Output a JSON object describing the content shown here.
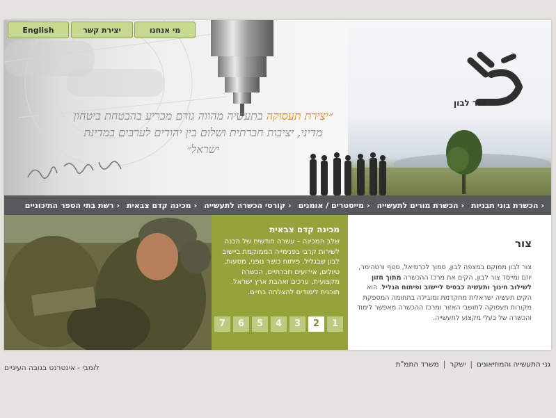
{
  "top_buttons": {
    "english": "English",
    "contact": "יצירת קשר",
    "about": "מי אנחנו"
  },
  "hero": {
    "quote_part1": "״יצירת תעסוקה",
    "quote_part2": " בתעשיה מהווה גורם מכריע בהבטחת ביטחון מדיני, יציבות חברתית ושלום בין יהודים לערבים במדינת ישראל״",
    "logo_text": "צור לבון"
  },
  "nav": {
    "items": [
      "הכשרת בוני תבניות",
      "הכשרת מורים לתעשייה",
      "מייסטרים / אומנים",
      "קורסי הכשרה לתעשייה",
      "מכינה קדם צבאית",
      "רשת בתי הספר התיכוניים"
    ]
  },
  "feature": {
    "title": "מכינה קדם צבאית",
    "text": "שלב המכינה – עשרה חודשים של הכנה לשירות קרבי בפנימייה הממוקמת ביישוב לבון שבגליל. פיתוח כושר גופני, מסעות, טיולים, אירועים חברתיים, הכשרה מקצועית, ערכים ואהבת ארץ ישראל. תוכנית לימודים להצלחה בחיים.",
    "pages": [
      "1",
      "2",
      "3",
      "4",
      "5",
      "6",
      "7"
    ],
    "active_page": "2"
  },
  "about": {
    "title": "צור",
    "text_a": "צור לבון ממוקם במצפה לבון, סמוך לכרמיאל, סטף ורטהימר, יוזם ומייסד צור לבון, הקים את מרכז ההכשרה ",
    "text_bold": "מתוך חזון לשילוב חינוך ותעשיה כבסיס ליישוב ופיתוח הגליל",
    "text_b": ". הוא הקים תעשיה ישראלית מתקדמת ומובילה בתחומה המספקת מקורות תעסוקה לתושבי האזור ומרכז ההכשרה מאפשר לימוד והכשרה של בעלי מקצוע לתעשייה."
  },
  "footer": {
    "link1": "גני התעשייה והמוזיאונים",
    "link2": "ישקר",
    "link3": "משרד התמ\"ת",
    "credit": "לומבי - אינטרנט בגובה העיניים"
  }
}
